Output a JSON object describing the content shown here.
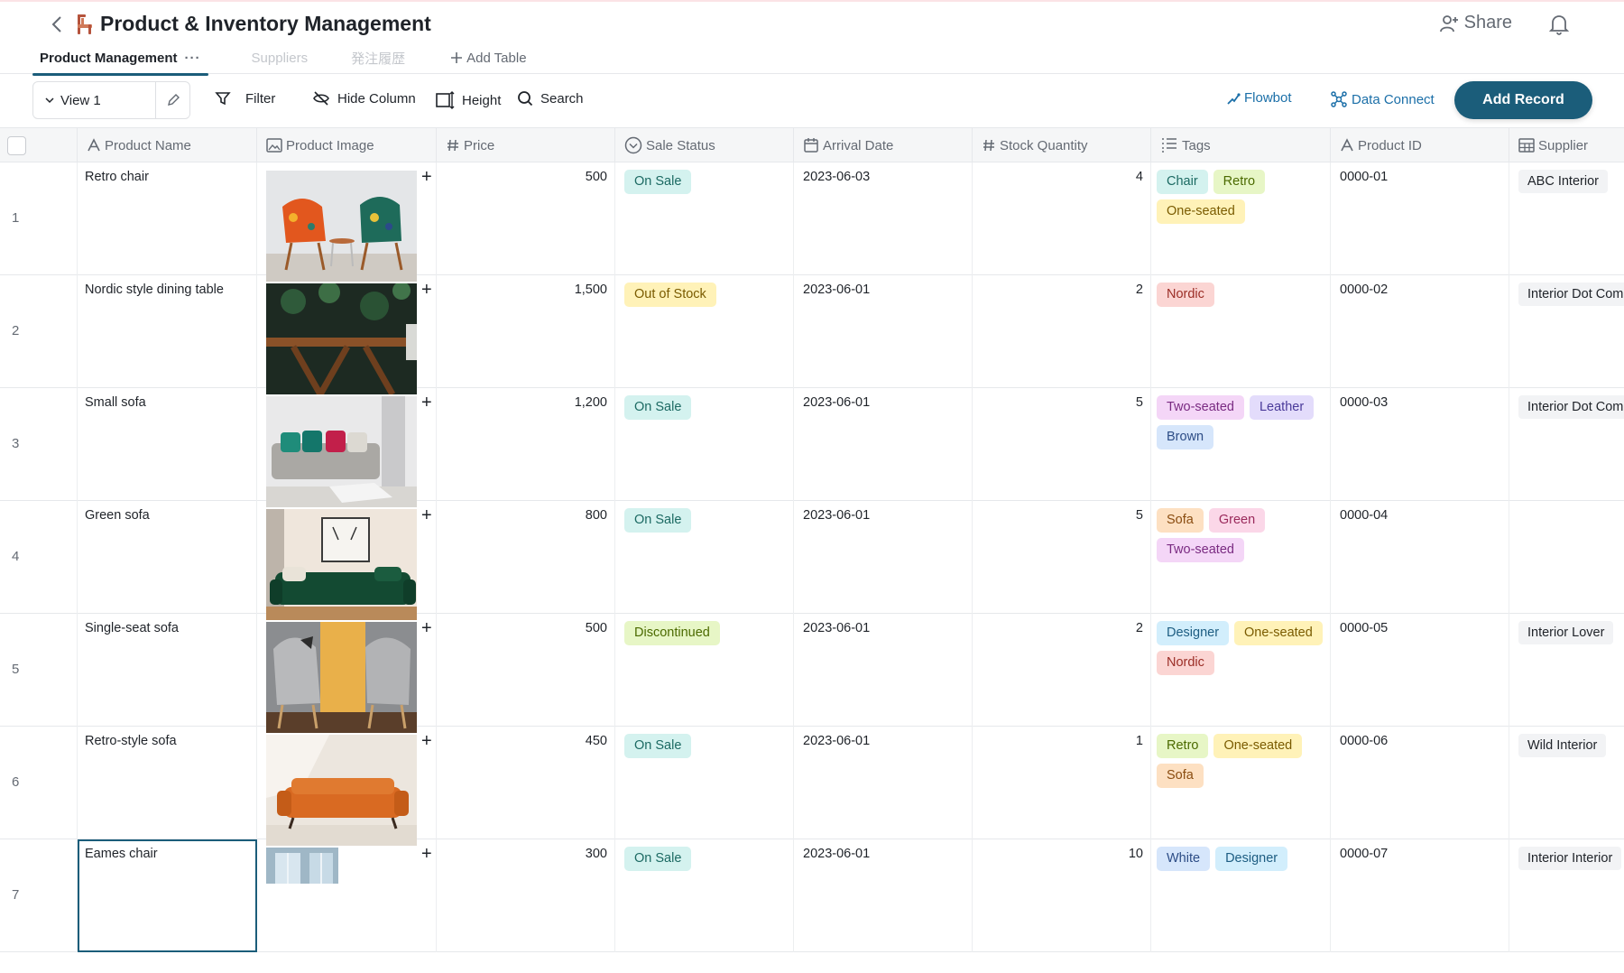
{
  "app": {
    "title": "Product & Inventory Management",
    "share_label": "Share"
  },
  "tabs": [
    {
      "label": "Product Management",
      "active": true
    },
    {
      "label": "Suppliers",
      "active": false
    },
    {
      "label": "発注履歴",
      "active": false
    }
  ],
  "tab_more": "···",
  "add_table_label": "Add Table",
  "toolbar": {
    "view_label": "View 1",
    "filter_label": "Filter",
    "hide_column_label": "Hide Column",
    "height_label": "Height",
    "search_label": "Search",
    "flowbot_label": "Flowbot",
    "data_connect_label": "Data Connect",
    "add_record_label": "Add Record"
  },
  "columns": [
    {
      "key": "name",
      "label": "Product Name",
      "icon": "text-icon"
    },
    {
      "key": "image",
      "label": "Product Image",
      "icon": "image-icon"
    },
    {
      "key": "price",
      "label": "Price",
      "icon": "number-icon"
    },
    {
      "key": "status",
      "label": "Sale Status",
      "icon": "status-icon"
    },
    {
      "key": "date",
      "label": "Arrival Date",
      "icon": "calendar-icon"
    },
    {
      "key": "stock",
      "label": "Stock Quantity",
      "icon": "number-icon"
    },
    {
      "key": "tags",
      "label": "Tags",
      "icon": "tags-icon"
    },
    {
      "key": "id",
      "label": "Product ID",
      "icon": "text-icon"
    },
    {
      "key": "supplier",
      "label": "Supplier",
      "icon": "link-table-icon"
    }
  ],
  "rows": [
    {
      "num": "1",
      "name": "Retro chair",
      "price": "500",
      "status": "On Sale",
      "date": "2023-06-03",
      "stock": "4",
      "tags": [
        "Chair",
        "Retro",
        "One-seated"
      ],
      "id": "0000-01",
      "supplier": "ABC Interior",
      "image": "two-colorful-chairs"
    },
    {
      "num": "2",
      "name": "Nordic style dining table",
      "price": "1,500",
      "status": "Out of Stock",
      "date": "2023-06-01",
      "stock": "2",
      "tags": [
        "Nordic"
      ],
      "id": "0000-02",
      "supplier": "Interior Dot Com",
      "image": "wooden-table-plants"
    },
    {
      "num": "3",
      "name": "Small sofa",
      "price": "1,200",
      "status": "On Sale",
      "date": "2023-06-01",
      "stock": "5",
      "tags": [
        "Two-seated",
        "Leather",
        "Brown"
      ],
      "id": "0000-03",
      "supplier": "Interior Dot Com",
      "image": "grey-sofa-cushions"
    },
    {
      "num": "4",
      "name": "Green sofa",
      "price": "800",
      "status": "On Sale",
      "date": "2023-06-01",
      "stock": "5",
      "tags": [
        "Sofa",
        "Green",
        "Two-seated"
      ],
      "id": "0000-04",
      "supplier": "",
      "image": "green-velvet-sofa"
    },
    {
      "num": "5",
      "name": "Single-seat sofa",
      "price": "500",
      "status": "Discontinued",
      "date": "2023-06-01",
      "stock": "2",
      "tags": [
        "Designer",
        "One-seated",
        "Nordic"
      ],
      "id": "0000-05",
      "supplier": "Interior Lover",
      "image": "two-grey-armchairs"
    },
    {
      "num": "6",
      "name": "Retro-style sofa",
      "price": "450",
      "status": "On Sale",
      "date": "2023-06-01",
      "stock": "1",
      "tags": [
        "Retro",
        "One-seated",
        "Sofa"
      ],
      "id": "0000-06",
      "supplier": "Wild Interior",
      "image": "orange-leather-sofa"
    },
    {
      "num": "7",
      "name": "Eames chair",
      "price": "300",
      "status": "On Sale",
      "date": "2023-06-01",
      "stock": "10",
      "tags": [
        "White",
        "Designer"
      ],
      "id": "0000-07",
      "supplier": "Interior Interior",
      "image": "white-chair-window"
    }
  ],
  "status_colors": {
    "On Sale": "t-teal",
    "Out of Stock": "t-yellow",
    "Discontinued": "t-green"
  },
  "tag_colors": {
    "Chair": "t-teal",
    "Retro": "t-green",
    "One-seated": "t-yellow",
    "Nordic": "t-red",
    "Two-seated": "t-purple",
    "Leather": "t-lav",
    "Brown": "t-blue",
    "Sofa": "t-peach",
    "Green": "t-pink",
    "Designer": "t-sky",
    "White": "t-blue"
  },
  "accent_color": "#1b5d7a"
}
